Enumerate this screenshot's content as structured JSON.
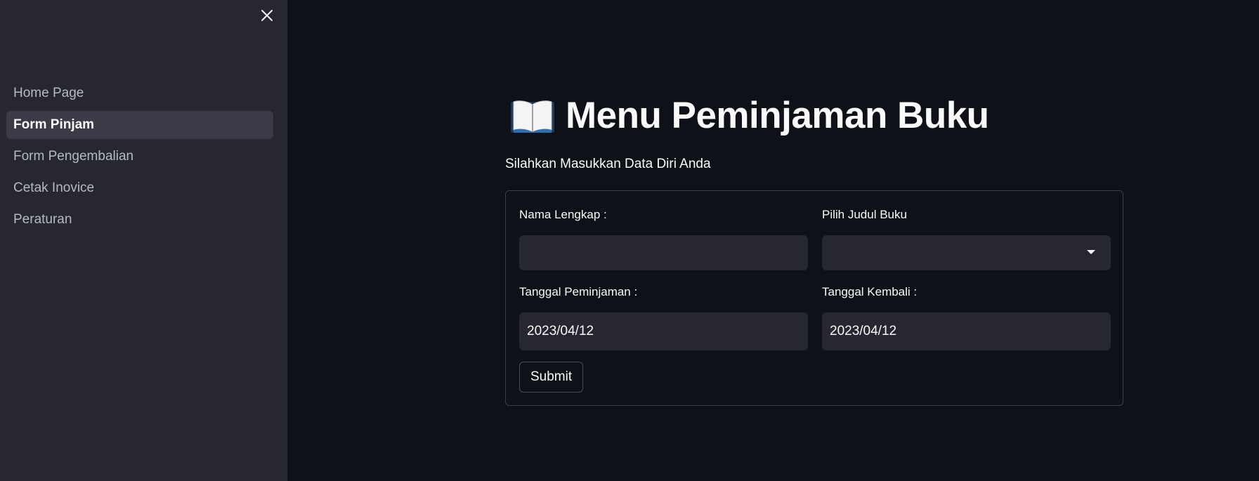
{
  "sidebar": {
    "close_icon": "close-icon",
    "items": [
      {
        "label": "Home Page",
        "active": false
      },
      {
        "label": "Form Pinjam",
        "active": true
      },
      {
        "label": "Form Pengembalian",
        "active": false
      },
      {
        "label": "Cetak Inovice",
        "active": false
      },
      {
        "label": "Peraturan",
        "active": false
      }
    ]
  },
  "main": {
    "title_icon": "open-book-icon",
    "title": "Menu Peminjaman Buku",
    "subtitle": "Silahkan Masukkan Data Diri Anda",
    "form": {
      "nama_label": "Nama Lengkap :",
      "nama_value": "",
      "judul_label": "Pilih Judul Buku",
      "judul_value": "",
      "tgl_pinjam_label": "Tanggal Peminjaman :",
      "tgl_pinjam_value": "2023/04/12",
      "tgl_kembali_label": "Tanggal Kembali :",
      "tgl_kembali_value": "2023/04/12",
      "submit_label": "Submit"
    }
  },
  "colors": {
    "background": "#0e1117",
    "sidebar": "#262730",
    "active_item": "#3a3b47",
    "input": "#262730",
    "text": "#fafafa"
  }
}
